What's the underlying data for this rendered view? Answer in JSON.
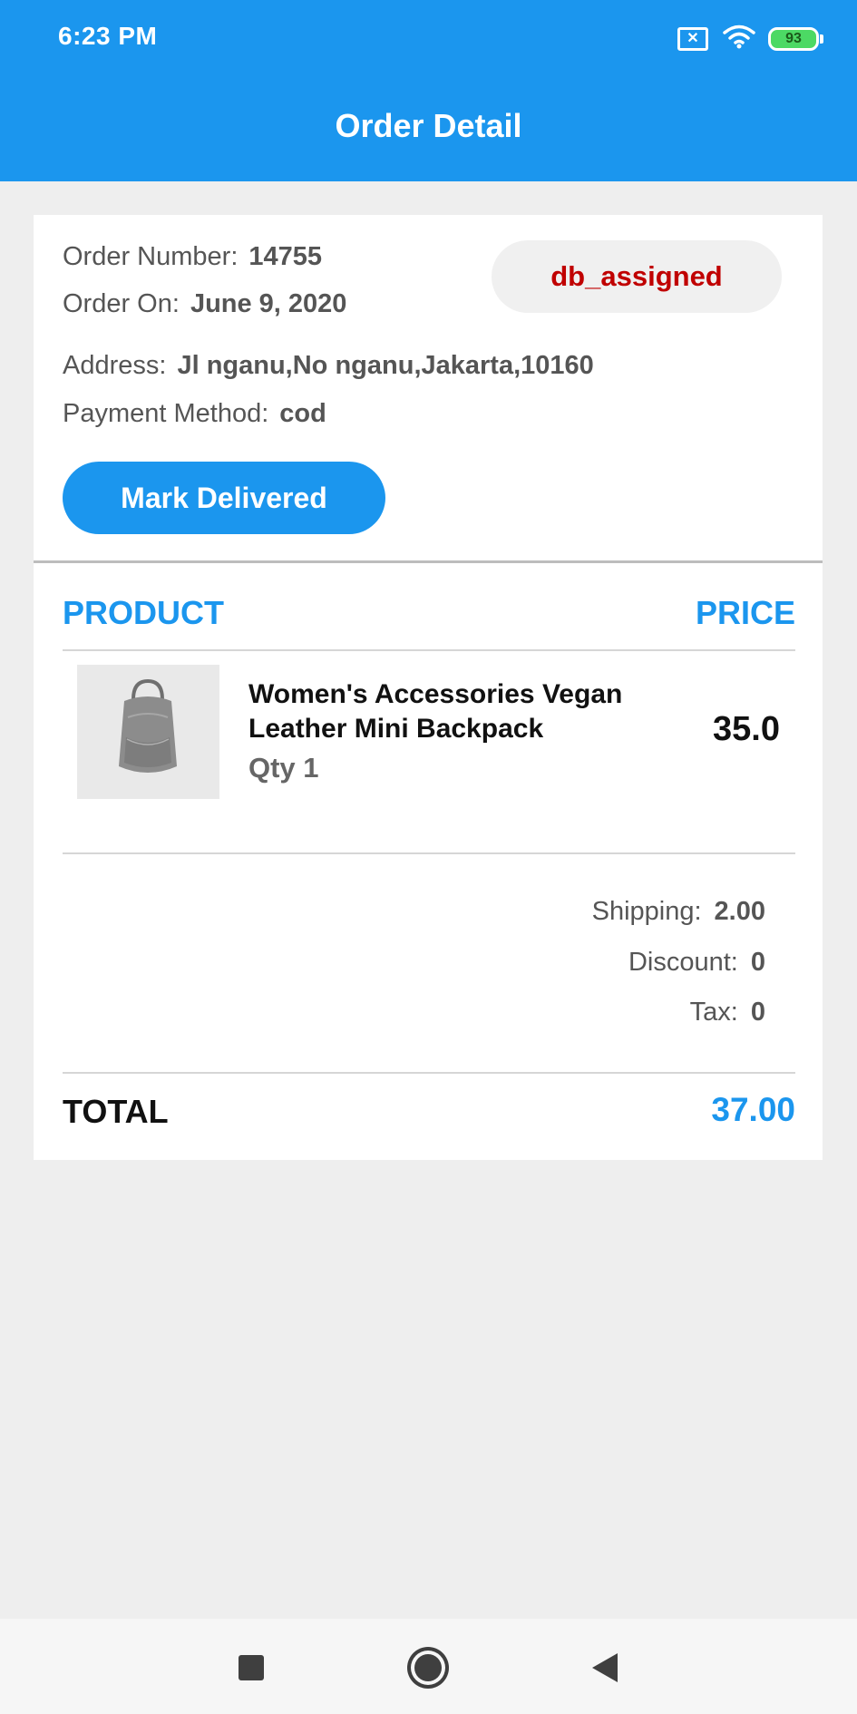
{
  "status_bar": {
    "time": "6:23 PM",
    "battery": "93",
    "icons": [
      "sim-card-x-icon",
      "wifi-icon",
      "battery-icon"
    ]
  },
  "header": {
    "title": "Order Detail"
  },
  "order": {
    "number_label": "Order Number:",
    "number": "14755",
    "date_label": "Order On:",
    "date": "June 9, 2020",
    "address_label": "Address:",
    "address": "Jl nganu,No nganu,Jakarta,10160",
    "payment_label": "Payment Method:",
    "payment": "cod",
    "status": "db_assigned",
    "action_label": "Mark Delivered"
  },
  "table": {
    "product_header": "PRODUCT",
    "price_header": "PRICE",
    "items": [
      {
        "name": "Women's Accessories Vegan Leather Mini Backpack",
        "qty": "Qty 1",
        "price": "35.0"
      }
    ]
  },
  "summary": {
    "shipping_label": "Shipping:",
    "shipping": "2.00",
    "discount_label": "Discount:",
    "discount": "0",
    "tax_label": "Tax:",
    "tax": "0",
    "total_label": "TOTAL",
    "total": "37.00"
  },
  "colors": {
    "primary": "#1b96ee",
    "status_text": "#c00000",
    "background": "#eeeeee"
  },
  "navbar": {
    "buttons": [
      "recents-square-icon",
      "home-circle-icon",
      "back-triangle-icon"
    ]
  }
}
